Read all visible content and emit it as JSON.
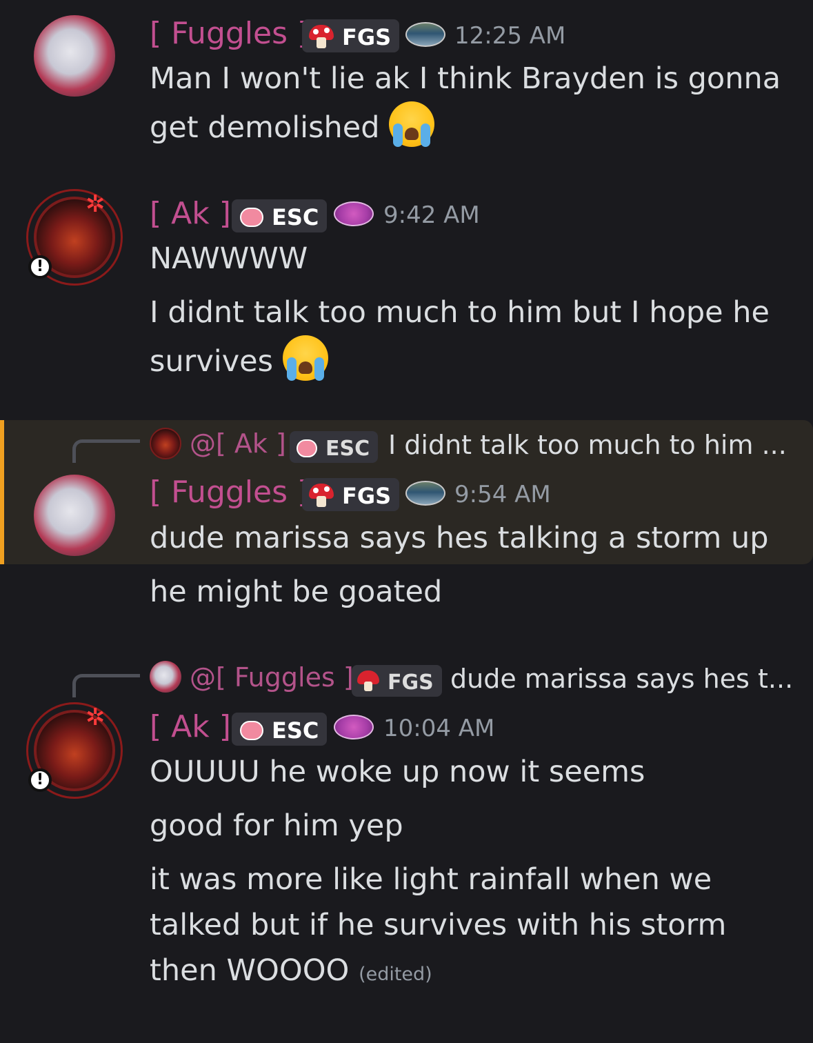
{
  "messages": [
    {
      "author": "[ Fuggles ]",
      "tag": "FGS",
      "time": "12:25 AM",
      "lines": [
        "Man I won't lie ak I think Brayden is gonna",
        "get demolished"
      ],
      "emoji": "loudly-crying-face"
    },
    {
      "author": "[ Ak ]",
      "tag": "ESC",
      "time": "9:42 AM",
      "lines": [
        "NAWWWW",
        "I didnt talk too much to him but I hope he",
        "survives"
      ],
      "emoji": "loudly-crying-face"
    },
    {
      "reply": {
        "author": "@[ Ak ]",
        "tag": "ESC",
        "text": "I didnt talk too much to him ..."
      },
      "author": "[ Fuggles ]",
      "tag": "FGS",
      "time": "9:54 AM",
      "lines": [
        "dude marissa says hes talking a storm up",
        "he might be goated"
      ],
      "highlighted": true
    },
    {
      "reply": {
        "author": "@[ Fuggles ]",
        "tag": "FGS",
        "text": "dude marissa says hes t..."
      },
      "author": "[ Ak ]",
      "tag": "ESC",
      "time": "10:04 AM",
      "lines": [
        "OUUUU he woke up now it seems",
        "good for him yep",
        "it was more like light rainfall when we",
        "talked but if he survives with his storm",
        "then WOOOO"
      ],
      "edited_label": "(edited)"
    }
  ],
  "colors": {
    "background": "#1a1a1e",
    "username": "#c24f90",
    "mention_highlight": "#2b2823",
    "mention_bar": "#f0a020",
    "timestamp": "#949ba4"
  }
}
